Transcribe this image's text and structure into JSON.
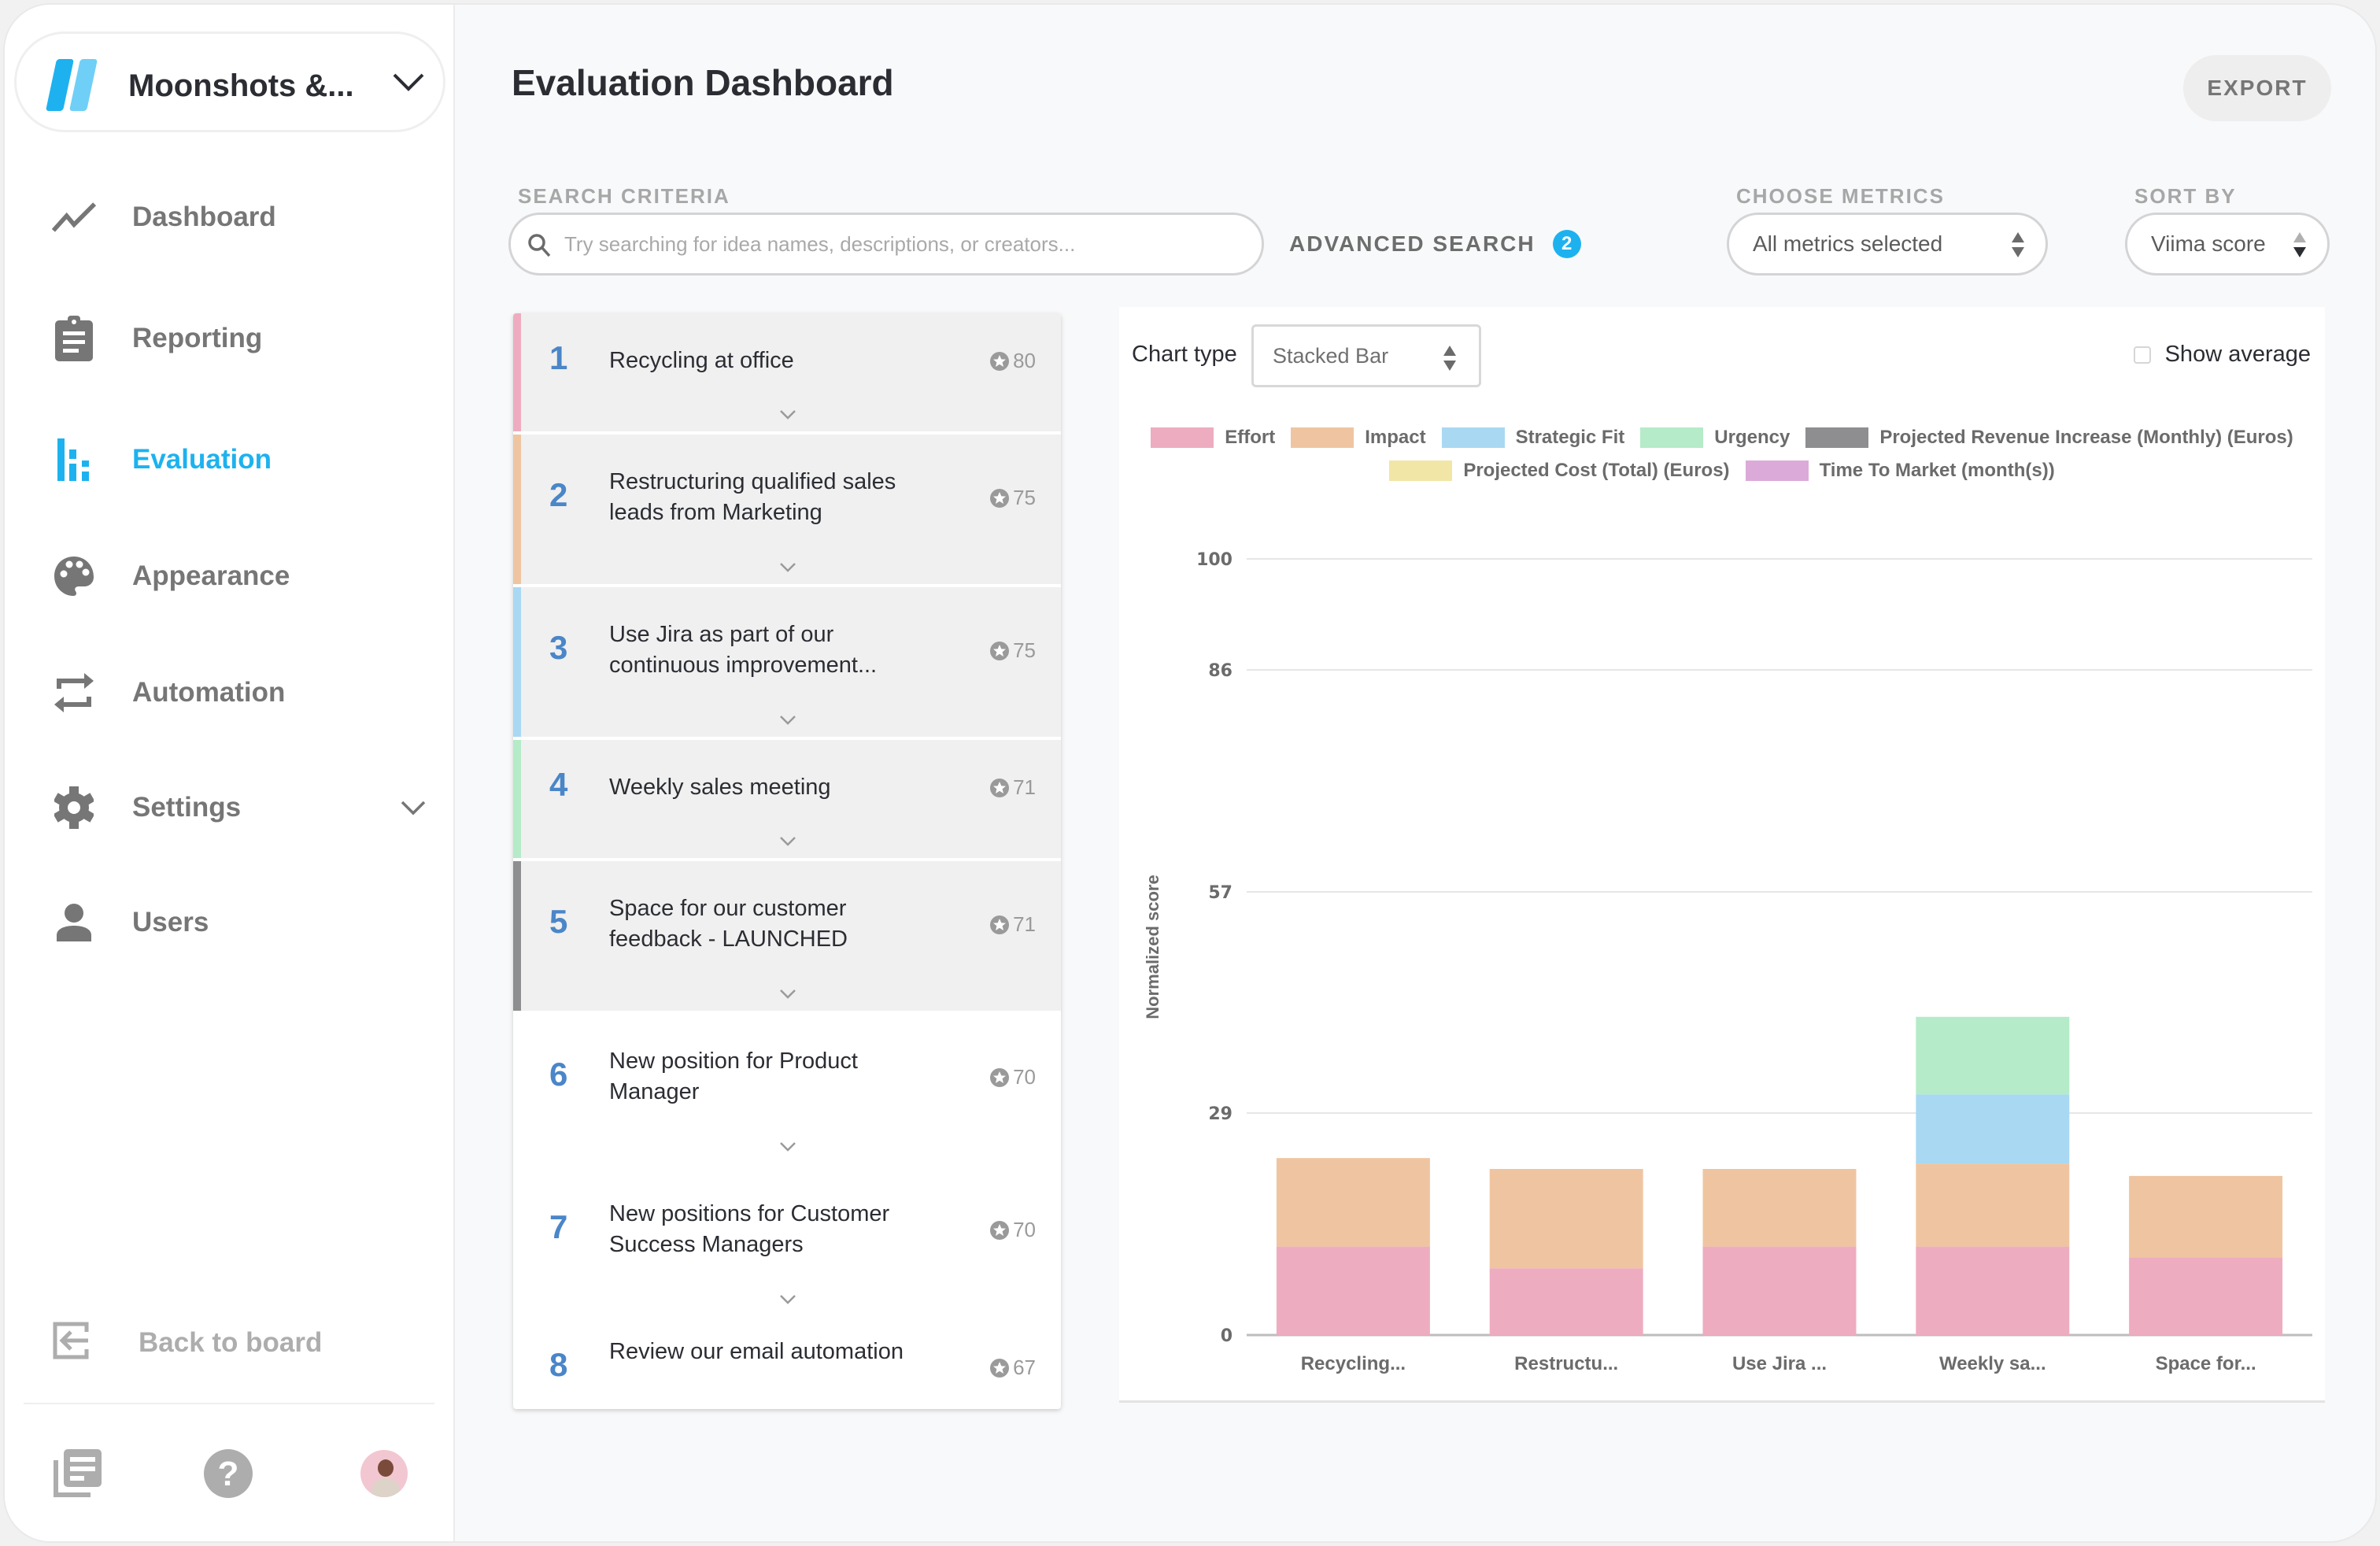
{
  "workspace": {
    "name": "Moonshots &...",
    "logo_colors": [
      "#1db2ef",
      "#6fcff7"
    ]
  },
  "sidebar": {
    "items": [
      {
        "label": "Dashboard",
        "icon": "trend-line-icon",
        "active": false
      },
      {
        "label": "Reporting",
        "icon": "clipboard-icon",
        "active": false
      },
      {
        "label": "Evaluation",
        "icon": "bar-chart-icon",
        "active": true
      },
      {
        "label": "Appearance",
        "icon": "palette-icon",
        "active": false
      },
      {
        "label": "Automation",
        "icon": "repeat-arrows-icon",
        "active": false
      },
      {
        "label": "Settings",
        "icon": "gear-icon",
        "active": false,
        "expandable": true
      },
      {
        "label": "Users",
        "icon": "user-icon",
        "active": false
      }
    ],
    "back_label": "Back to board",
    "bottom_icons": [
      "documents-icon",
      "help-icon",
      "avatar"
    ]
  },
  "header": {
    "title": "Evaluation Dashboard",
    "export_label": "EXPORT"
  },
  "filters": {
    "search_label": "SEARCH CRITERIA",
    "search_placeholder": "Try searching for idea names, descriptions, or creators...",
    "search_value": "",
    "advanced_label": "ADVANCED SEARCH",
    "advanced_count": "2",
    "metrics_label": "CHOOSE METRICS",
    "metrics_value": "All metrics selected",
    "sort_label": "SORT BY",
    "sort_value": "Viima score"
  },
  "ideas": [
    {
      "rank": "1",
      "title": "Recycling at office",
      "score": "80",
      "color": "#eeacc0",
      "shaded": true
    },
    {
      "rank": "2",
      "title": "Restructuring qualified sales leads from Marketing",
      "score": "75",
      "color": "#efc5a1",
      "shaded": true
    },
    {
      "rank": "3",
      "title": "Use Jira as part of our continuous improvement...",
      "score": "75",
      "color": "#a9d8f3",
      "shaded": true
    },
    {
      "rank": "4",
      "title": "Weekly sales meeting",
      "score": "71",
      "color": "#b5ebc8",
      "shaded": true
    },
    {
      "rank": "5",
      "title": "Space for our customer feedback - LAUNCHED",
      "score": "71",
      "color": "#8e8e90",
      "shaded": true
    },
    {
      "rank": "6",
      "title": "New position for Product Manager",
      "score": "70",
      "color": "",
      "shaded": false
    },
    {
      "rank": "7",
      "title": "New positions for Customer Success Managers",
      "score": "70",
      "color": "",
      "shaded": false
    },
    {
      "rank": "8",
      "title": "Review our email automation",
      "score": "67",
      "color": "",
      "shaded": false
    }
  ],
  "chart_controls": {
    "chart_type_label": "Chart type",
    "chart_type_value": "Stacked Bar",
    "show_average_label": "Show average",
    "show_average_checked": false
  },
  "chart_data": {
    "type": "bar",
    "stacked": true,
    "title": "",
    "xlabel": "",
    "ylabel": "Normalized score",
    "ylim": [
      0,
      100
    ],
    "yticks": [
      0,
      28.6,
      57.1,
      85.7,
      100
    ],
    "ytick_labels": [
      "0",
      "29",
      "57",
      "86",
      "100"
    ],
    "grid": true,
    "legend_position": "top-center",
    "categories": [
      "Recycling...",
      "Restructu...",
      "Use Jira ...",
      "Weekly sa...",
      "Space for..."
    ],
    "series": [
      {
        "name": "Effort",
        "color": "#eeacc0",
        "values": [
          11.4,
          8.6,
          11.4,
          11.4,
          10.0
        ]
      },
      {
        "name": "Impact",
        "color": "#efc5a1",
        "values": [
          11.4,
          12.8,
          10.0,
          10.7,
          10.5
        ]
      },
      {
        "name": "Strategic Fit",
        "color": "#a9d8f3",
        "values": [
          0,
          0,
          0,
          8.9,
          0
        ]
      },
      {
        "name": "Urgency",
        "color": "#b5ebc8",
        "values": [
          0,
          0,
          0,
          10.0,
          0
        ]
      },
      {
        "name": "Projected Revenue Increase (Monthly) (Euros)",
        "color": "#8e8e90",
        "values": [
          0,
          0,
          0,
          0,
          0
        ]
      },
      {
        "name": "Projected Cost (Total) (Euros)",
        "color": "#f1e6a6",
        "values": [
          0,
          0,
          0,
          0,
          0
        ]
      },
      {
        "name": "Time To Market (month(s))",
        "color": "#dcaad9",
        "values": [
          0,
          0,
          0,
          0,
          0
        ]
      }
    ]
  }
}
